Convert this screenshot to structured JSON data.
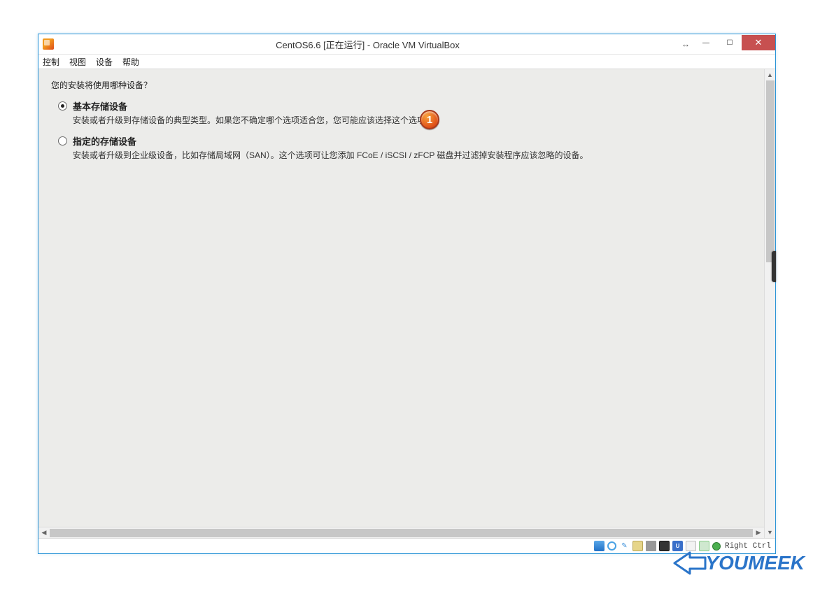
{
  "window": {
    "title": "CentOS6.6 [正在运行] - Oracle VM VirtualBox"
  },
  "menu": {
    "control": "控制",
    "view": "视图",
    "devices": "设备",
    "help": "帮助"
  },
  "installer": {
    "prompt": "您的安装将使用哪种设备？",
    "options": [
      {
        "title": "基本存储设备",
        "desc": "安装或者升级到存储设备的典型类型。如果您不确定哪个选项适合您，您可能应该选择这个选项。",
        "selected": true
      },
      {
        "title": "指定的存储设备",
        "desc": "安装或者升级到企业级设备，比如存储局域网（SAN）。这个选项可让您添加 FCoE / iSCSI / zFCP 磁盘并过滤掉安装程序应该忽略的设备。",
        "selected": false
      }
    ]
  },
  "annotation": {
    "badge1": "1"
  },
  "statusbar": {
    "host_key": "Right Ctrl"
  },
  "watermark": {
    "text": "YOUMEEK"
  }
}
